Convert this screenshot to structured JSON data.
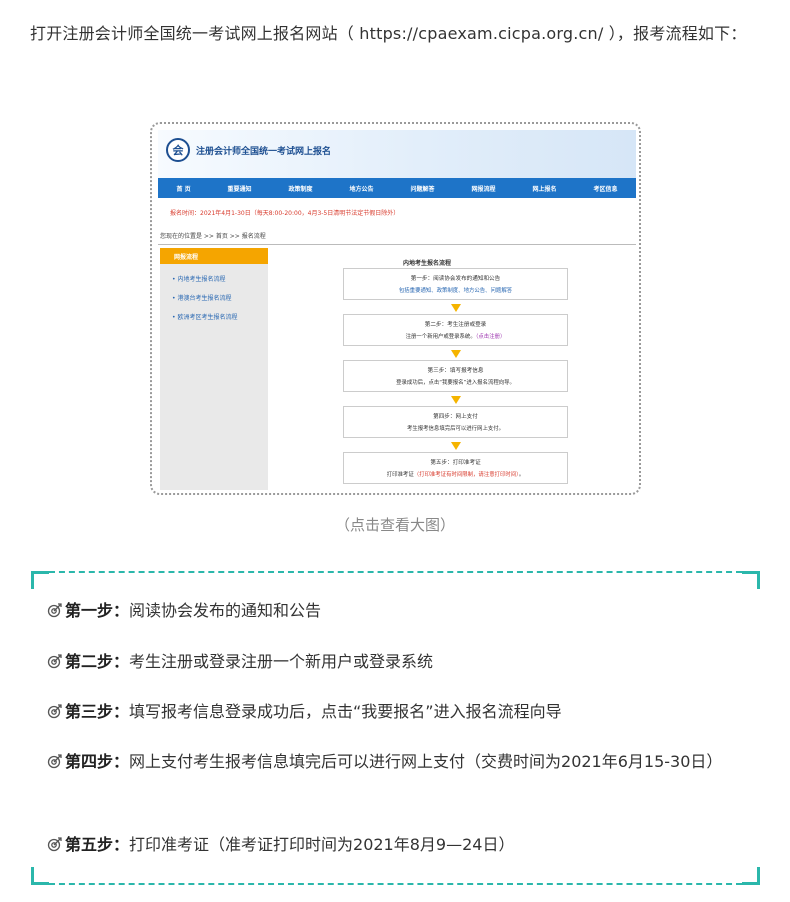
{
  "intro": "打开注册会计师全国统一考试网上报名网站（ https://cpaexam.cicpa.org.cn/ ），报考流程如下：",
  "screenshot": {
    "site_title": "注册会计师全国统一考试网上报名",
    "nav": [
      "首 页",
      "重要通知",
      "政策制度",
      "地方公告",
      "问题解答",
      "网报流程",
      "网上报名",
      "考区信息"
    ],
    "notice": "报名时间：2021年4月1-30日（每天8:00-20:00，4月3-5日清明节法定节假日除外）",
    "location": "您现在的位置是 >> 首页 >> 报名流程",
    "sidebar_head": "网报流程",
    "sidebar_items": [
      "内地考生报名流程",
      "港澳台考生报名流程",
      "欧洲考区考生报名流程"
    ],
    "main_title": "内地考生报名流程",
    "steps": [
      {
        "title": "第一步：阅读协会发布的通知和公告",
        "desc": "包括重要通知、政策制度、地方公告、问题解答"
      },
      {
        "title": "第二步：考生注册或登录",
        "desc": "注册一个新用户或登录系统。",
        "link": "（点击注册）"
      },
      {
        "title": "第三步：填写报考信息",
        "desc": "登录成功后，点击“我要报名”进入报名流程向导。"
      },
      {
        "title": "第四步：网上支付",
        "desc": "考生报考信息填完后可以进行网上支付。"
      },
      {
        "title": "第五步：打印准考证",
        "desc_pre": "打印准考证",
        "desc_red": "（打印准考证有时间限制，请注意打印时间）",
        "desc_post": "。"
      }
    ]
  },
  "caption": "（点击查看大图）",
  "steps": [
    {
      "label": "第一步：",
      "text": "阅读协会发布的通知和公告"
    },
    {
      "label": "第二步：",
      "text": "考生注册或登录注册一个新用户或登录系统"
    },
    {
      "label": "第三步：",
      "text": "填写报考信息登录成功后，点击“我要报名”进入报名流程向导"
    },
    {
      "label": "第四步：",
      "text": "网上支付考生报考信息填完后可以进行网上支付（交费时间为2021年6月15-30日）"
    },
    {
      "label": "第五步：",
      "text": "打印准考证（准考证打印时间为2021年8月9—24日）"
    }
  ],
  "colors": {
    "accent_teal": "#2bb7ab",
    "nav_blue": "#1e74c8",
    "sidebar_orange": "#f5a500",
    "notice_red": "#d83a2c"
  },
  "icons": {
    "step_marker": "target-arrow-icon"
  }
}
